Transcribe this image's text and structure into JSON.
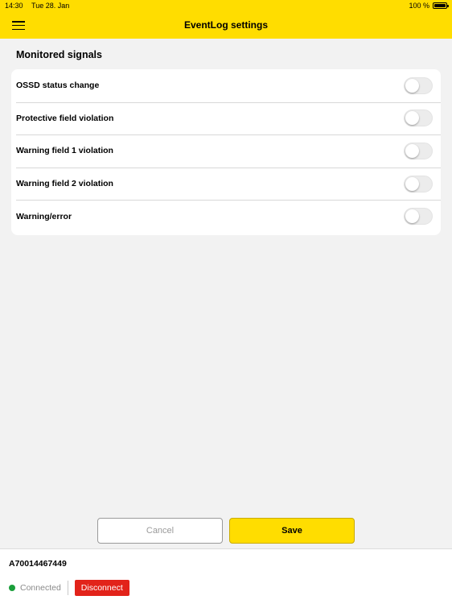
{
  "status_bar": {
    "time": "14:30",
    "date": "Tue 28. Jan",
    "battery": "100 %",
    "battery_level": 1.0
  },
  "header": {
    "title": "EventLog settings",
    "menu_icon": "hamburger-menu-icon",
    "background": "#ffdd00"
  },
  "section": {
    "title": "Monitored signals"
  },
  "signals": [
    {
      "label": "OSSD status change",
      "enabled": false
    },
    {
      "label": "Protective field violation",
      "enabled": false
    },
    {
      "label": "Warning field 1 violation",
      "enabled": false
    },
    {
      "label": "Warning field 2 violation",
      "enabled": false
    },
    {
      "label": "Warning/error",
      "enabled": false
    }
  ],
  "actions": {
    "cancel_label": "Cancel",
    "save_label": "Save"
  },
  "footer": {
    "device_id": "A70014467449",
    "connection_status": "Connected",
    "status_color": "#1a9e3a",
    "disconnect_label": "Disconnect",
    "disconnect_color": "#e2231a"
  }
}
